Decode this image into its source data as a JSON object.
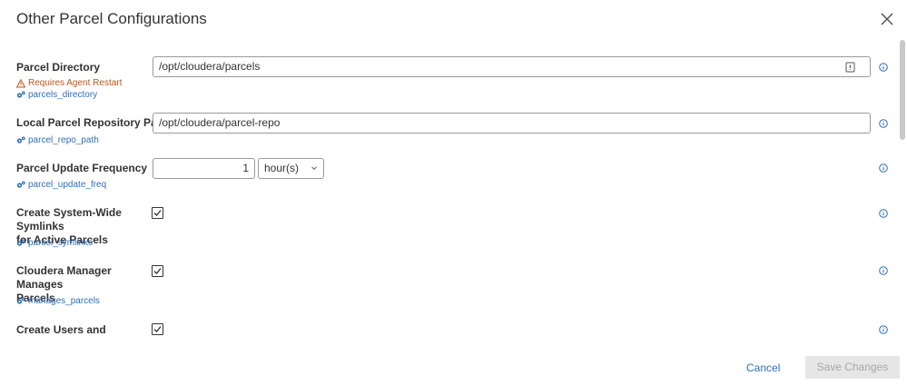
{
  "dialog": {
    "title": "Other Parcel Configurations",
    "close_icon": "close-icon"
  },
  "fields": {
    "parcel_directory": {
      "label": "Parcel Directory",
      "warning": "Requires Agent Restart",
      "param": "parcels_directory",
      "value": "/opt/cloudera/parcels"
    },
    "local_repo_path": {
      "label": "Local Parcel Repository Path",
      "param": "parcel_repo_path",
      "value": "/opt/cloudera/parcel-repo"
    },
    "update_frequency": {
      "label": "Parcel Update Frequency",
      "param": "parcel_update_freq",
      "value": "1",
      "unit": "hour(s)"
    },
    "symlinks": {
      "label_line1": "Create System-Wide Symlinks",
      "label_line2": "for Active Parcels",
      "param": "parcel_symlinks",
      "checked": true
    },
    "manages_parcels": {
      "label_line1": "Cloudera Manager Manages",
      "label_line2": "Parcels",
      "param": "manages_parcels",
      "checked": true
    },
    "create_users": {
      "label_line1": "Create Users and Groups, and",
      "checked": true
    }
  },
  "footer": {
    "cancel_label": "Cancel",
    "save_label": "Save Changes"
  },
  "colors": {
    "link": "#2f6fb6",
    "warning": "#c0551b",
    "disabled_bg": "#e6e6e6",
    "disabled_text": "#a8a8a8"
  }
}
